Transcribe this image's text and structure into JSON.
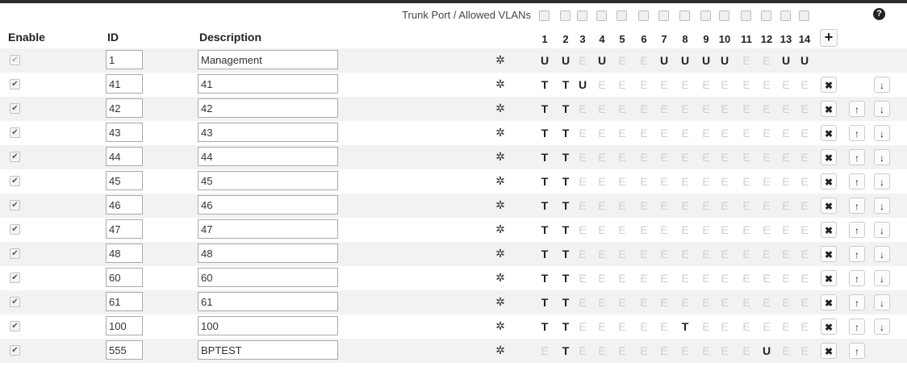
{
  "header": {
    "trunk_label": "Trunk Port / Allowed VLANs",
    "help_icon": "?",
    "col_enable": "Enable",
    "col_id": "ID",
    "col_description": "Description",
    "add_button": "+"
  },
  "ports": [
    "1",
    "2",
    "3",
    "4",
    "5",
    "6",
    "7",
    "8",
    "9",
    "10",
    "11",
    "12",
    "13",
    "14"
  ],
  "icons": {
    "gear": "✲",
    "delete": "✖",
    "move_up": "🡑",
    "move_down": "🡓",
    "check": "✔"
  },
  "vlans": [
    {
      "enabled": true,
      "locked": true,
      "id": "1",
      "description": "Management",
      "ports": [
        "U",
        "U",
        "E",
        "U",
        "E",
        "E",
        "U",
        "U",
        "U",
        "U",
        "E",
        "E",
        "U",
        "U"
      ],
      "del": false,
      "up": false,
      "down": false
    },
    {
      "enabled": true,
      "locked": false,
      "id": "41",
      "description": "41",
      "ports": [
        "T",
        "T",
        "U",
        "E",
        "E",
        "E",
        "E",
        "E",
        "E",
        "E",
        "E",
        "E",
        "E",
        "E"
      ],
      "del": true,
      "up": false,
      "down": true
    },
    {
      "enabled": true,
      "locked": false,
      "id": "42",
      "description": "42",
      "ports": [
        "T",
        "T",
        "E",
        "E",
        "E",
        "E",
        "E",
        "E",
        "E",
        "E",
        "E",
        "E",
        "E",
        "E"
      ],
      "del": true,
      "up": true,
      "down": true
    },
    {
      "enabled": true,
      "locked": false,
      "id": "43",
      "description": "43",
      "ports": [
        "T",
        "T",
        "E",
        "E",
        "E",
        "E",
        "E",
        "E",
        "E",
        "E",
        "E",
        "E",
        "E",
        "E"
      ],
      "del": true,
      "up": true,
      "down": true
    },
    {
      "enabled": true,
      "locked": false,
      "id": "44",
      "description": "44",
      "ports": [
        "T",
        "T",
        "E",
        "E",
        "E",
        "E",
        "E",
        "E",
        "E",
        "E",
        "E",
        "E",
        "E",
        "E"
      ],
      "del": true,
      "up": true,
      "down": true
    },
    {
      "enabled": true,
      "locked": false,
      "id": "45",
      "description": "45",
      "ports": [
        "T",
        "T",
        "E",
        "E",
        "E",
        "E",
        "E",
        "E",
        "E",
        "E",
        "E",
        "E",
        "E",
        "E"
      ],
      "del": true,
      "up": true,
      "down": true
    },
    {
      "enabled": true,
      "locked": false,
      "id": "46",
      "description": "46",
      "ports": [
        "T",
        "T",
        "E",
        "E",
        "E",
        "E",
        "E",
        "E",
        "E",
        "E",
        "E",
        "E",
        "E",
        "E"
      ],
      "del": true,
      "up": true,
      "down": true
    },
    {
      "enabled": true,
      "locked": false,
      "id": "47",
      "description": "47",
      "ports": [
        "T",
        "T",
        "E",
        "E",
        "E",
        "E",
        "E",
        "E",
        "E",
        "E",
        "E",
        "E",
        "E",
        "E"
      ],
      "del": true,
      "up": true,
      "down": true
    },
    {
      "enabled": true,
      "locked": false,
      "id": "48",
      "description": "48",
      "ports": [
        "T",
        "T",
        "E",
        "E",
        "E",
        "E",
        "E",
        "E",
        "E",
        "E",
        "E",
        "E",
        "E",
        "E"
      ],
      "del": true,
      "up": true,
      "down": true
    },
    {
      "enabled": true,
      "locked": false,
      "id": "60",
      "description": "60",
      "ports": [
        "T",
        "T",
        "E",
        "E",
        "E",
        "E",
        "E",
        "E",
        "E",
        "E",
        "E",
        "E",
        "E",
        "E"
      ],
      "del": true,
      "up": true,
      "down": true
    },
    {
      "enabled": true,
      "locked": false,
      "id": "61",
      "description": "61",
      "ports": [
        "T",
        "T",
        "E",
        "E",
        "E",
        "E",
        "E",
        "E",
        "E",
        "E",
        "E",
        "E",
        "E",
        "E"
      ],
      "del": true,
      "up": true,
      "down": true
    },
    {
      "enabled": true,
      "locked": false,
      "id": "100",
      "description": "100",
      "ports": [
        "T",
        "T",
        "E",
        "E",
        "E",
        "E",
        "E",
        "T",
        "E",
        "E",
        "E",
        "E",
        "E",
        "E"
      ],
      "del": true,
      "up": true,
      "down": true
    },
    {
      "enabled": true,
      "locked": false,
      "id": "555",
      "description": "BPTEST",
      "ports": [
        "E",
        "T",
        "E",
        "E",
        "E",
        "E",
        "E",
        "E",
        "E",
        "E",
        "E",
        "U",
        "E",
        "E"
      ],
      "del": true,
      "up": true,
      "down": false
    }
  ]
}
